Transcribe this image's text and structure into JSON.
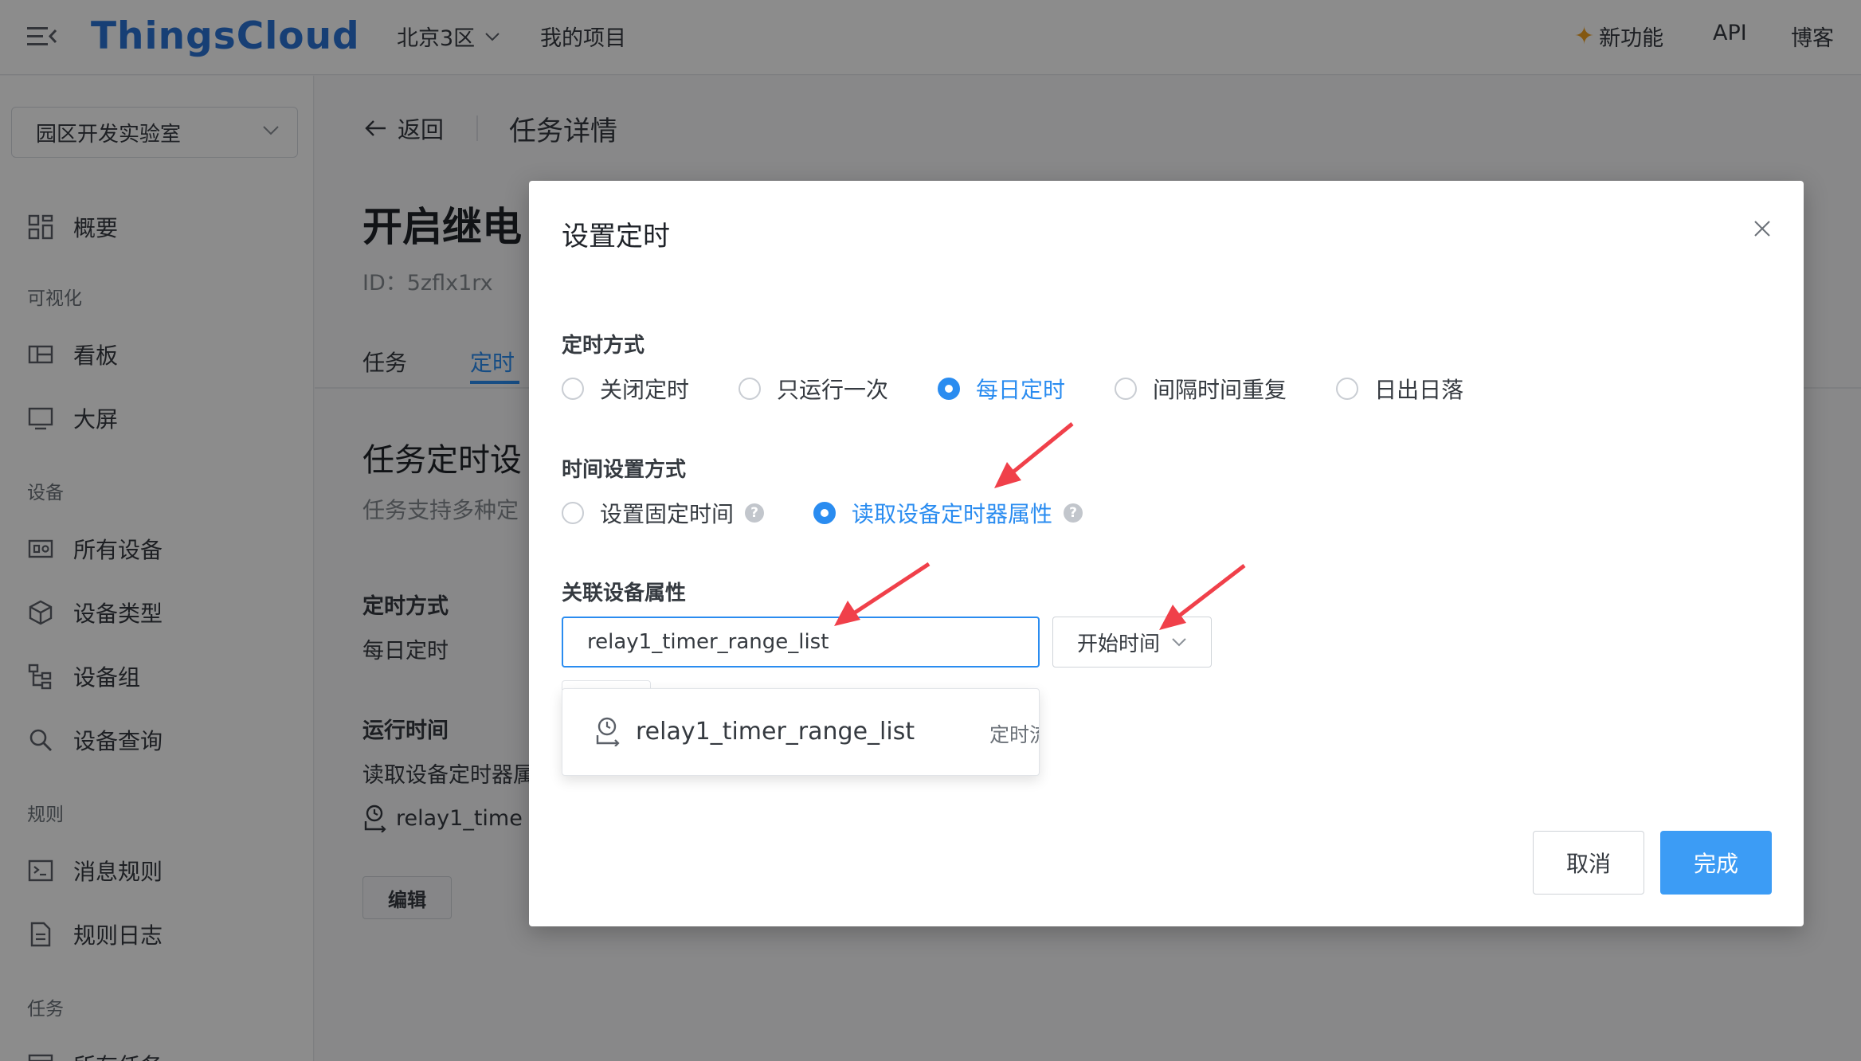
{
  "header": {
    "brand": "ThingsCloud",
    "region": "北京3区",
    "my_projects": "我的项目",
    "new_features": "新功能",
    "api": "API",
    "blog": "博客"
  },
  "sidebar": {
    "project": "园区开发实验室",
    "overview": "概要",
    "group_visual": "可视化",
    "dashboard": "看板",
    "bigscreen": "大屏",
    "group_devices": "设备",
    "all_devices": "所有设备",
    "device_types": "设备类型",
    "device_groups": "设备组",
    "device_query": "设备查询",
    "group_rules": "规则",
    "message_rules": "消息规则",
    "rule_logs": "规则日志",
    "group_tasks": "任务",
    "all_tasks": "所有任务"
  },
  "main": {
    "back": "返回",
    "page_title": "任务详情",
    "task_title": "开启继电",
    "task_id": "ID：5zflx1rx",
    "tab_task": "任务",
    "tab_timer": "定时",
    "section_title": "任务定时设",
    "section_desc": "任务支持多种定",
    "timer_mode_label": "定时方式",
    "timer_mode_value": "每日定时",
    "run_time_label": "运行时间",
    "run_time_value": "读取设备定时器属",
    "attr_value": "relay1_time",
    "edit_button": "编辑"
  },
  "modal": {
    "title": "设置定时",
    "timer_mode_label": "定时方式",
    "timer_modes": [
      "关闭定时",
      "只运行一次",
      "每日定时",
      "间隔时间重复",
      "日出日落"
    ],
    "timer_mode_selected": "每日定时",
    "time_setting_label": "时间设置方式",
    "time_settings": [
      "设置固定时间",
      "读取设备定时器属性"
    ],
    "time_setting_selected": "读取设备定时器属性",
    "related_attr_label": "关联设备属性",
    "attr_input_value": "relay1_timer_range_list",
    "time_select_value": "开始时间",
    "dropdown_item": "relay1_timer_range_list",
    "dropdown_item_note": "定时流",
    "cancel": "取消",
    "confirm": "完成"
  },
  "colors": {
    "brand": "#2a74d6",
    "accent": "#2a8cf0",
    "primary_button": "#3c9cf5",
    "annotation_arrow": "#f0404a"
  }
}
